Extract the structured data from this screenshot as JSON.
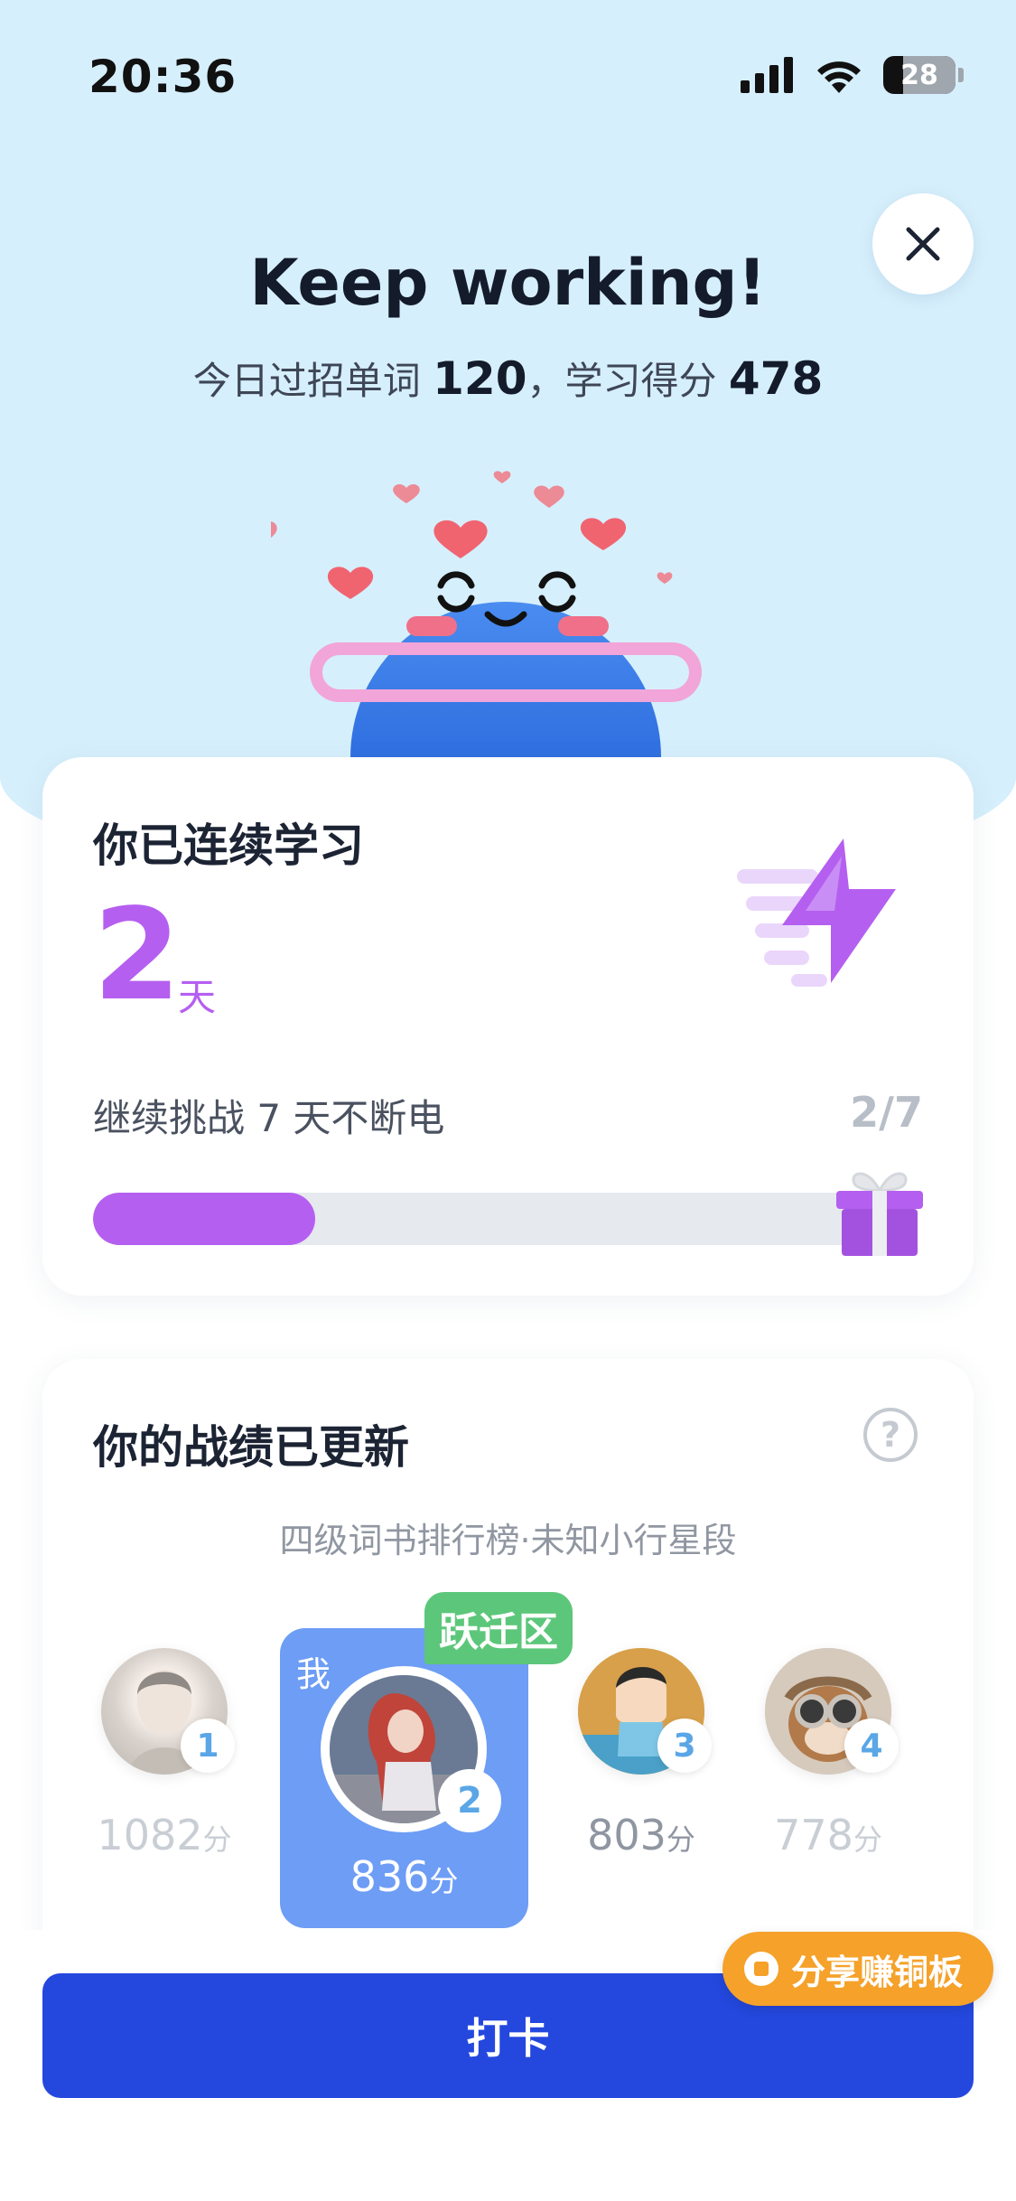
{
  "status_bar": {
    "time": "20:36",
    "battery": "28",
    "battery_fraction": 0.28
  },
  "header": {
    "title": "Keep working!",
    "sub_prefix": "今日过招单词",
    "words_count": "120",
    "sub_middle": "，学习得分",
    "score": "478"
  },
  "streak": {
    "title": "你已连续学习",
    "days": "2",
    "unit": "天",
    "challenge": "继续挑战 7 天不断电",
    "progress_text": "2/7",
    "progress_fraction": 0.2857,
    "accent_color": "#b55ff0"
  },
  "ranking": {
    "title": "你的战绩已更新",
    "help_symbol": "?",
    "subtitle": "四级词书排行榜·未知小行星段",
    "score_unit": "分",
    "me_label": "我",
    "zone_tag": "跃迁区",
    "entries": [
      {
        "rank": "1",
        "score": "1082"
      },
      {
        "rank": "2",
        "score": "836"
      },
      {
        "rank": "3",
        "score": "803"
      },
      {
        "rank": "4",
        "score": "778"
      }
    ]
  },
  "actions": {
    "share_label": "分享赚铜板",
    "checkin_label": "打卡"
  },
  "colors": {
    "primary": "#2448de",
    "streak": "#b55ff0",
    "zone": "#5cc77a",
    "share": "#f5a12a",
    "sky": "#d6effc"
  },
  "icons": [
    "signal-icon",
    "wifi-icon",
    "battery-icon",
    "close-icon",
    "lightning-icon",
    "gift-icon",
    "help-icon",
    "coin-icon"
  ]
}
